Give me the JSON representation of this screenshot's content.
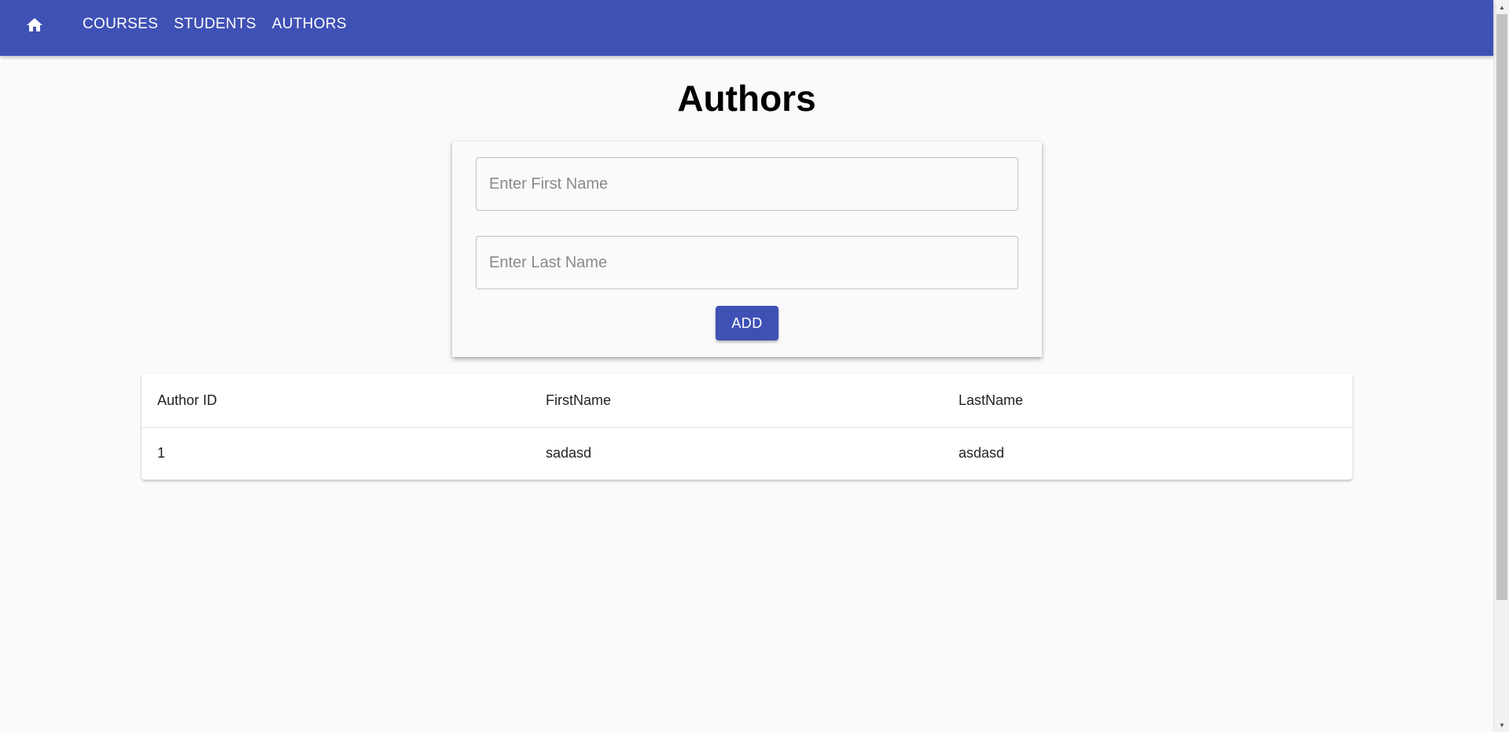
{
  "navbar": {
    "home_icon": "home-icon",
    "links": [
      {
        "label": "COURSES"
      },
      {
        "label": "STUDENTS"
      },
      {
        "label": "AUTHORS"
      }
    ],
    "color": "#3f51b5"
  },
  "page": {
    "title": "Authors"
  },
  "form": {
    "first_name_placeholder": "Enter First Name",
    "first_name_value": "",
    "last_name_placeholder": "Enter Last Name",
    "last_name_value": "",
    "add_label": "ADD"
  },
  "table": {
    "headers": [
      "Author ID",
      "FirstName",
      "LastName"
    ],
    "rows": [
      {
        "id": "1",
        "first": "sadasd",
        "last": "asdasd"
      }
    ]
  }
}
